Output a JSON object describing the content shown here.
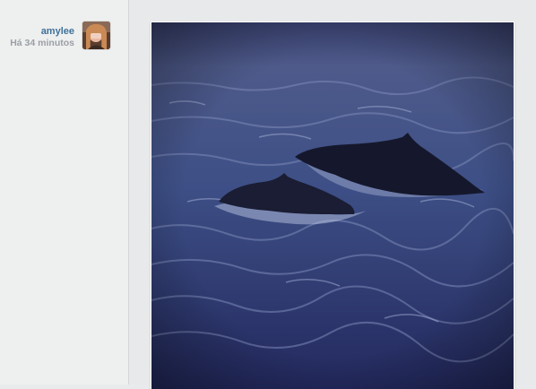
{
  "post": {
    "username": "amylee",
    "timestamp": "Há 34 minutos",
    "avatar_icon": "user-avatar-photo",
    "photo_subject": "whale-sea-photo"
  },
  "colors": {
    "username_link": "#3f729b",
    "timestamp_text": "#9aa0a6",
    "page_bg": "#e9eaeb"
  }
}
